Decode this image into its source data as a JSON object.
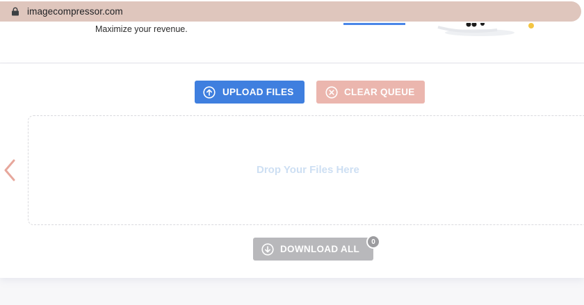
{
  "browser": {
    "url": "imagecompressor.com",
    "icon": "lock-icon"
  },
  "ad": {
    "text": "Maximize your revenue.",
    "accent_color": "#4a86e8"
  },
  "toolbar": {
    "upload_label": "UPLOAD FILES",
    "upload_icon": "arrow-up-circle-icon",
    "upload_color": "#3f7fdf",
    "clear_label": "CLEAR QUEUE",
    "clear_icon": "x-circle-icon",
    "clear_color": "#ebb6ae"
  },
  "dropzone": {
    "text": "Drop Your Files Here"
  },
  "navigation": {
    "prev_icon": "chevron-left-icon",
    "arrow_color": "#e7a79c"
  },
  "download": {
    "label": "DOWNLOAD ALL",
    "icon": "arrow-down-circle-icon",
    "count": "0",
    "color": "#b8b8bb"
  }
}
